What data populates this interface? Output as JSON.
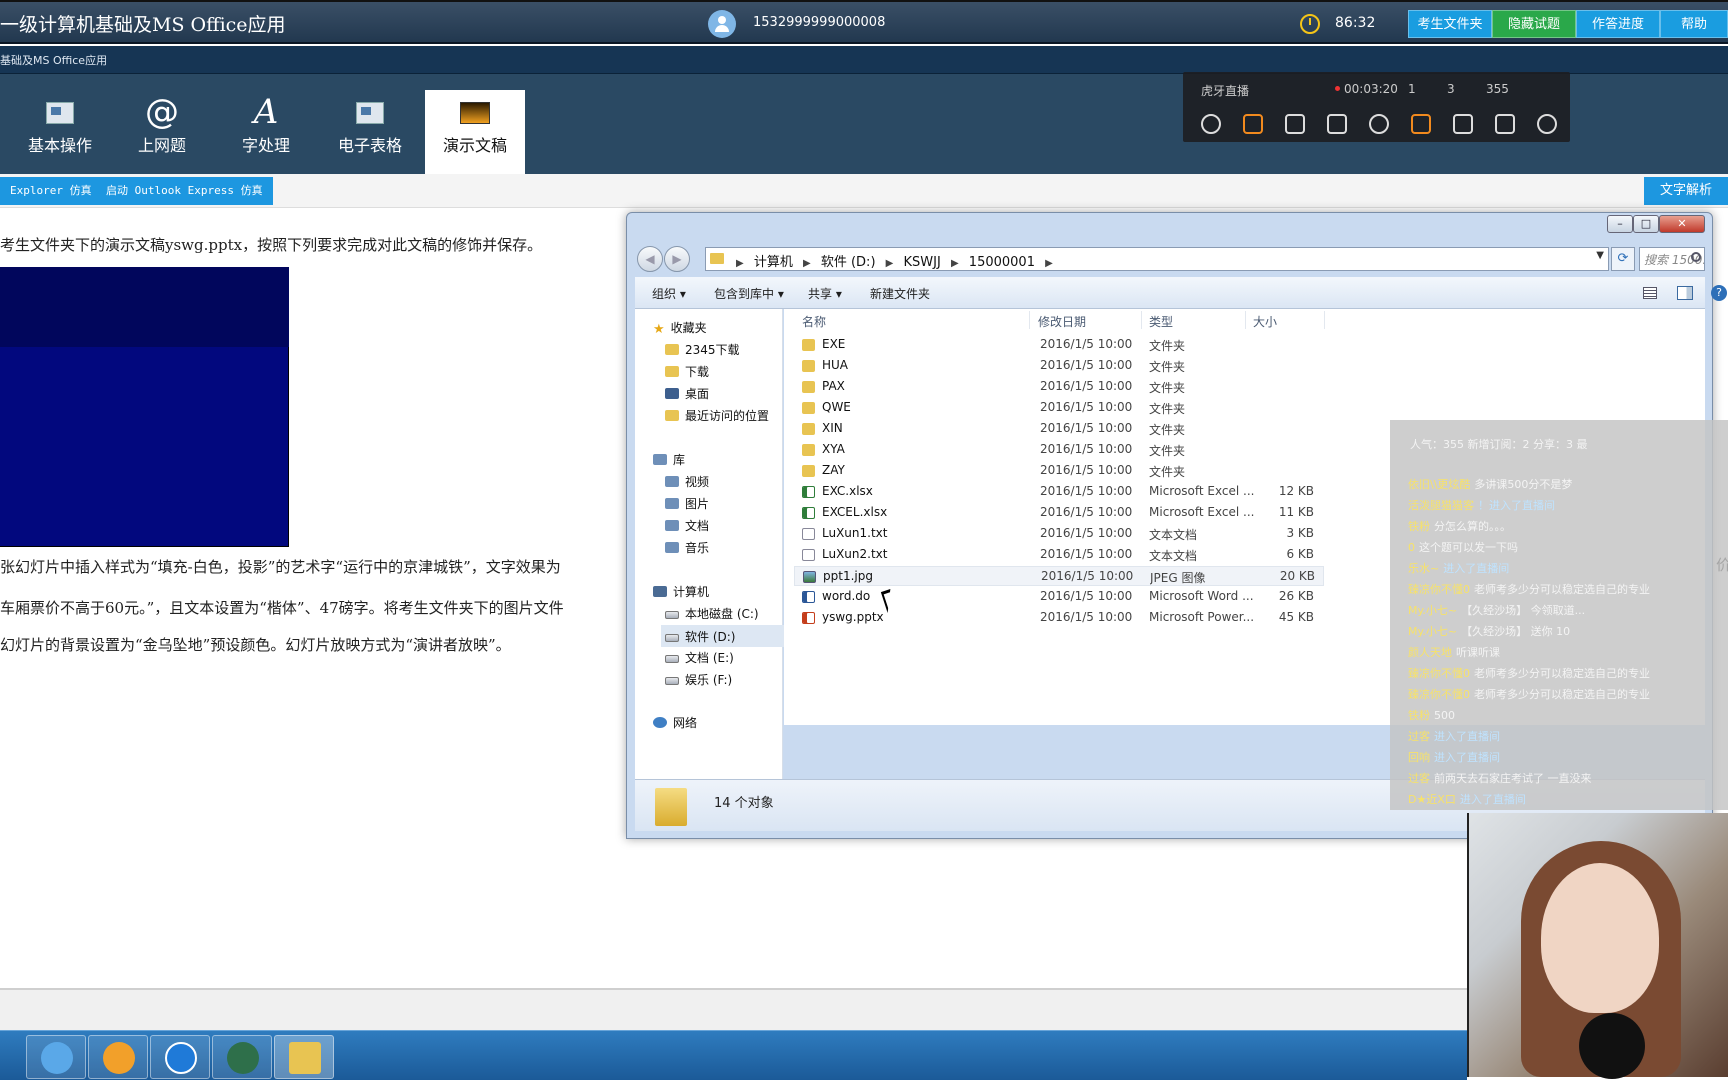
{
  "topbar": {
    "title": "一级计算机基础及MS Office应用",
    "user_id": "1532999999000008",
    "timer": "86:32",
    "buttons": {
      "folder": "考生文件夹",
      "hide": "隐藏试题",
      "progress": "作答进度",
      "help": "帮助"
    }
  },
  "subbar": {
    "label": "基础及MS Office应用"
  },
  "tabs": [
    {
      "label": "基本操作",
      "icon": "basic-ops-icon"
    },
    {
      "label": "上网题",
      "icon": "at-icon"
    },
    {
      "label": "字处理",
      "icon": "letter-a-icon"
    },
    {
      "label": "电子表格",
      "icon": "spreadsheet-icon"
    },
    {
      "label": "演示文稿",
      "icon": "slideshow-icon"
    }
  ],
  "toolbar": {
    "ie": "Explorer 仿真",
    "outlook": "启动 Outlook Express 仿真",
    "analysis": "文字解析"
  },
  "question": {
    "intro": "考生文件夹下的演示文稿yswg.pptx，按照下列要求完成对此文稿的修饰并保存。",
    "line1": "张幻灯片中插入样式为“填充-白色，投影”的艺术字“运行中的京津城铁”，文字效果为",
    "line2": "车厢票价不高于60元。”，且文本设置为“楷体”、47磅字。将考生文件夹下的图片文件",
    "line3": "幻灯片的背景设置为“金乌坠地”预设颜色。幻灯片放映方式为“演讲者放映”。",
    "edge": "价"
  },
  "explorer": {
    "breadcrumb": [
      "计算机",
      "软件 (D:)",
      "KSWJJ",
      "15000001"
    ],
    "search_placeholder": "搜索 1500...",
    "commands": {
      "organize": "组织 ▾",
      "library": "包含到库中 ▾",
      "share": "共享 ▾",
      "new_folder": "新建文件夹"
    },
    "nav": {
      "favorites": "收藏夹",
      "downloads_2345": "2345下载",
      "downloads": "下载",
      "desktop": "桌面",
      "recent": "最近访问的位置",
      "libraries": "库",
      "videos": "视频",
      "pictures": "图片",
      "documents": "文档",
      "music": "音乐",
      "computer": "计算机",
      "drive_c": "本地磁盘 (C:)",
      "drive_d": "软件 (D:)",
      "drive_e": "文档 (E:)",
      "drive_f": "娱乐 (F:)",
      "network": "网络"
    },
    "columns": {
      "name": "名称",
      "date": "修改日期",
      "type": "类型",
      "size": "大小"
    },
    "files": [
      {
        "name": "EXE",
        "date": "2016/1/5 10:00",
        "type": "文件夹",
        "size": "",
        "kind": "folder"
      },
      {
        "name": "HUA",
        "date": "2016/1/5 10:00",
        "type": "文件夹",
        "size": "",
        "kind": "folder"
      },
      {
        "name": "PAX",
        "date": "2016/1/5 10:00",
        "type": "文件夹",
        "size": "",
        "kind": "folder"
      },
      {
        "name": "QWE",
        "date": "2016/1/5 10:00",
        "type": "文件夹",
        "size": "",
        "kind": "folder"
      },
      {
        "name": "XIN",
        "date": "2016/1/5 10:00",
        "type": "文件夹",
        "size": "",
        "kind": "folder"
      },
      {
        "name": "XYA",
        "date": "2016/1/5 10:00",
        "type": "文件夹",
        "size": "",
        "kind": "folder"
      },
      {
        "name": "ZAY",
        "date": "2016/1/5 10:00",
        "type": "文件夹",
        "size": "",
        "kind": "folder"
      },
      {
        "name": "EXC.xlsx",
        "date": "2016/1/5 10:00",
        "type": "Microsoft Excel ...",
        "size": "12 KB",
        "kind": "xlsx"
      },
      {
        "name": "EXCEL.xlsx",
        "date": "2016/1/5 10:00",
        "type": "Microsoft Excel ...",
        "size": "11 KB",
        "kind": "xlsx"
      },
      {
        "name": "LuXun1.txt",
        "date": "2016/1/5 10:00",
        "type": "文本文档",
        "size": "3 KB",
        "kind": "txt"
      },
      {
        "name": "LuXun2.txt",
        "date": "2016/1/5 10:00",
        "type": "文本文档",
        "size": "6 KB",
        "kind": "txt"
      },
      {
        "name": "ppt1.jpg",
        "date": "2016/1/5 10:00",
        "type": "JPEG 图像",
        "size": "20 KB",
        "kind": "jpg"
      },
      {
        "name": "word.do",
        "date": "2016/1/5 10:00",
        "type": "Microsoft Word ...",
        "size": "26 KB",
        "kind": "doc"
      },
      {
        "name": "yswg.pptx",
        "date": "2016/1/5 10:00",
        "type": "Microsoft Power...",
        "size": "45 KB",
        "kind": "ppt"
      }
    ],
    "status": "14 个对象"
  },
  "live": {
    "logo": "虎牙直播",
    "duration": "00:03:20",
    "stat1": "1",
    "stat2": "3",
    "viewers": "355"
  },
  "chat": {
    "stats": "人气：355    新增订阅：2    分享：3    最",
    "lines": [
      {
        "nick": "依旧\\\\更炫酷",
        "text": "多讲课500分不是梦"
      },
      {
        "nick": "活泼腿猫猫客",
        "text": "！进入了直播间"
      },
      {
        "nick": "铁粉",
        "text": "分怎么算的。。。"
      },
      {
        "nick": "0",
        "text": "这个题可以发一下吗"
      },
      {
        "nick": "乐水~",
        "text": "进入了直播间"
      },
      {
        "nick": "臻凉你不懂0",
        "text": "老师考多少分可以稳定选自己的专业"
      },
      {
        "nick": "My.小七~",
        "text": "【久经沙场】 今领取道..."
      },
      {
        "nick": "My.小七~",
        "text": "【久经沙场】 送你 10"
      },
      {
        "nick": "颜人天地",
        "text": "听课听课"
      },
      {
        "nick": "臻凉你不懂0",
        "text": "老师考多少分可以稳定选自己的专业"
      },
      {
        "nick": "臻凉你不懂0",
        "text": "老师考多少分可以稳定选自己的专业"
      },
      {
        "nick": "铁粉",
        "text": "500"
      },
      {
        "nick": "过客",
        "text": "进入了直播间"
      },
      {
        "nick": "回响",
        "text": "进入了直播间"
      },
      {
        "nick": "过客",
        "text": "前两天去石家庄考试了 一直没来"
      },
      {
        "nick": "D★近X口",
        "text": "进入了直播间"
      }
    ]
  },
  "colors": {
    "accent_blue": "#1a9de0",
    "accent_green": "#2aa84a",
    "ribbon": "#2a4963",
    "slide_blue": "#02087e"
  }
}
